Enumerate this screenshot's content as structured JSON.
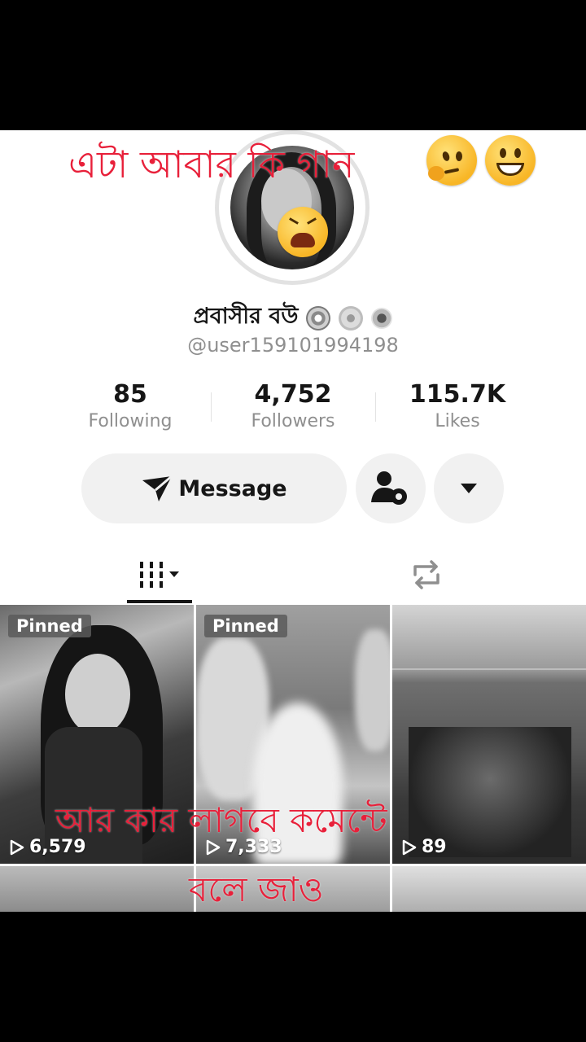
{
  "overlay": {
    "top_caption": "এটা আবার কি গান",
    "bottom_caption_line1": "আর কার লাগবে কমেন্টে",
    "bottom_caption_line2": "বলে জাও",
    "emojis": [
      "thinking-emoji",
      "grinning-emoji",
      "tired-face-emoji"
    ]
  },
  "profile": {
    "display_name": "প্রবাসীর বউ",
    "badges": [
      "flower-icon",
      "flower-icon",
      "sunflower-icon"
    ],
    "handle": "@user15910199419​8"
  },
  "stats": [
    {
      "value": "85",
      "label": "Following"
    },
    {
      "value": "4,752",
      "label": "Followers"
    },
    {
      "value": "115.7K",
      "label": "Likes"
    }
  ],
  "actions": {
    "message_label": "Message",
    "friend_settings_icon": "person-gear-icon",
    "more_icon": "caret-down-icon"
  },
  "tabs": [
    {
      "icon": "videos-grid-icon",
      "active": true
    },
    {
      "icon": "repost-icon",
      "active": false
    }
  ],
  "videos": [
    {
      "pinned_label": "Pinned",
      "views": "6,579"
    },
    {
      "pinned_label": "Pinned",
      "views": "7,333"
    },
    {
      "pinned_label": "",
      "views": "89"
    }
  ],
  "colors": {
    "caption_red": "#e8203a",
    "page_bg": "#ffffff",
    "letterbox": "#000000"
  }
}
